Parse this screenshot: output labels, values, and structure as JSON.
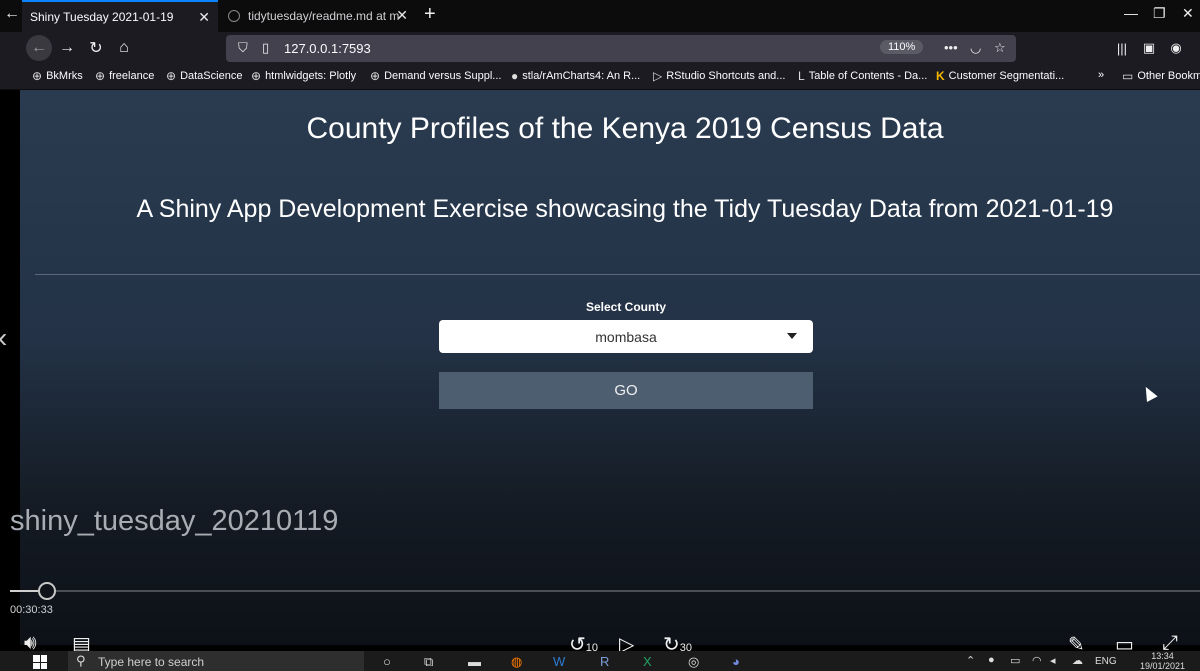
{
  "browser": {
    "tabs": [
      {
        "label": "Shiny Tuesday 2021-01-19",
        "active": true
      },
      {
        "label": "tidytuesday/readme.md at ma",
        "active": false
      }
    ],
    "url": "127.0.0.1:7593",
    "zoom": "110%",
    "bookmarks": [
      "BkMrks",
      "freelance",
      "DataScience",
      "htmlwidgets: Plotly",
      "Demand versus Suppl...",
      "stla/rAmCharts4: An R...",
      "RStudio Shortcuts and...",
      "Table of Contents - Da...",
      "Customer Segmentati...",
      "Other Bookm"
    ],
    "icons": {
      "back": "left-arrow-icon",
      "forward": "right-arrow-icon",
      "reload": "reload-icon",
      "home": "home-icon",
      "menu": "hamburger-icon"
    },
    "accent": "#0a84ff"
  },
  "app": {
    "title": "County Profiles of the Kenya 2019 Census Data",
    "subtitle": "A Shiny App Development Exercise showcasing the Tidy Tuesday Data from 2021-01-19",
    "select_label": "Select County",
    "select_value": "mombasa",
    "go_label": "GO"
  },
  "video": {
    "title": "shiny_tuesday_20210119",
    "time": "00:30:33",
    "skip_back": "10",
    "skip_forward": "30"
  },
  "taskbar": {
    "search_placeholder": "Type here to search",
    "lang": "ENG",
    "time": "13:34",
    "date": "19/01/2021"
  }
}
